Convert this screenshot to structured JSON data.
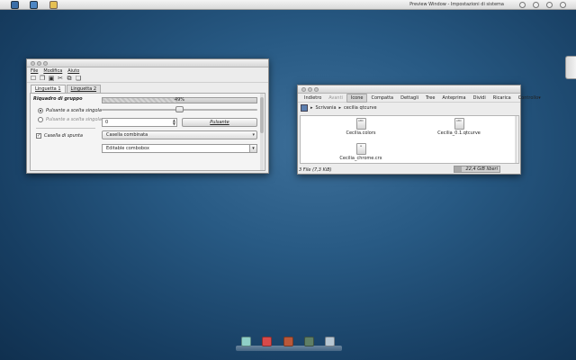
{
  "top_panel": {
    "title": "Preview Window - Impostazioni di sistema",
    "launchers": [
      "desktop-icon",
      "files-icon",
      "appearance-icon"
    ],
    "tray": [
      "network-icon",
      "volume-icon",
      "clock-icon",
      "power-icon"
    ],
    "clock_badge": ""
  },
  "style_window": {
    "menu": [
      "File",
      "Modifica",
      "Aiuto"
    ],
    "toolbar_icons": [
      "new-icon",
      "open-icon",
      "save-icon",
      "cut-icon",
      "copy-icon",
      "paste-icon"
    ],
    "tabs": [
      "Linguetta 1",
      "Linguetta 2"
    ],
    "group_title": "Riquadro di gruppo",
    "radio1": "Pulsante a scelta singola",
    "radio2": "Pulsante a scelta singola",
    "checkbox": "Casella di spunta",
    "progress_text": "49%",
    "progress_value": 0.49,
    "slider_value": 0.5,
    "spin_value": "0",
    "push_button": "Pulsante",
    "combo": "Casella combinata",
    "editable_combo": "Editable combobox"
  },
  "file_manager": {
    "toolbar": [
      "Indietro",
      "Avanti",
      "Icone",
      "Compatta",
      "Dettagli",
      "Tree",
      "Anteprima",
      "Dividi",
      "Ricarica",
      "Controllo"
    ],
    "active_view": "Icone",
    "breadcrumbs": [
      "Scrivania",
      "cecilia qtcurve"
    ],
    "files": [
      "Cecilia.colors",
      "Cecilia_0.1.qtcurve",
      "Cecilia_chrome.crx"
    ],
    "status": "3 File (7,3 KiB)",
    "free_space": "22,4 GiB liberi",
    "free_fraction": 0.15
  },
  "dock": {
    "items": [
      "files-icon",
      "calendar-icon",
      "music-icon",
      "settings-icon",
      "trash-icon"
    ],
    "colors": [
      "#8fd0c8",
      "#d84a4a",
      "#b9583a",
      "#5f7f66",
      "#b7c7d3"
    ]
  }
}
